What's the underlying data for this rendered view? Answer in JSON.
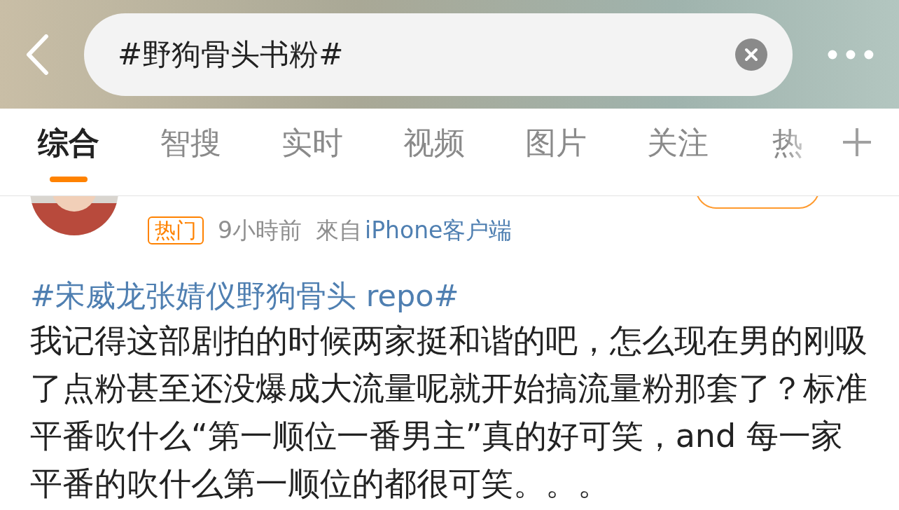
{
  "search": {
    "value": "#野狗骨头书粉#"
  },
  "tabs": [
    {
      "label": "综合",
      "selected": true
    },
    {
      "label": "智搜",
      "selected": false
    },
    {
      "label": "实时",
      "selected": false
    },
    {
      "label": "视频",
      "selected": false
    },
    {
      "label": "图片",
      "selected": false
    },
    {
      "label": "关注",
      "selected": false
    },
    {
      "label": "热",
      "selected": false
    }
  ],
  "post": {
    "badge": "热门",
    "time": "9小時前",
    "source_prefix": "來自",
    "source": "iPhone客户端",
    "topic": "#宋威龙张婧仪野狗骨头 repo#",
    "body": "我记得这部剧拍的时候两家挺和谐的吧，怎么现在男的刚吸了点粉甚至还没爆成大流量呢就开始搞流量粉那套了？标准平番吹什么“第一顺位一番男主”真的好可笑，and 每一家平番的吹什么第一顺位的都很可笑。。。"
  }
}
